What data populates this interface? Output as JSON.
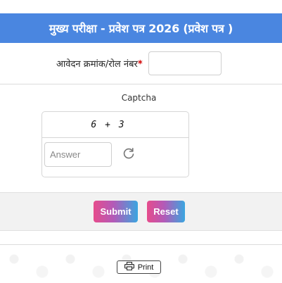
{
  "header": {
    "title": "मुख्य परीक्षा - प्रवेश पत्र 2026 (प्रवेश पत्र )"
  },
  "form": {
    "roll_label": "आवेदन क्रमांक/रोल नंबर",
    "required_mark": "*",
    "roll_value": ""
  },
  "captcha": {
    "title": "Captcha",
    "question": "6 + 3",
    "answer_placeholder": "Answer",
    "refresh_icon": "refresh-icon"
  },
  "buttons": {
    "submit": "Submit",
    "reset": "Reset"
  },
  "footer": {
    "print_label": "Print",
    "print_icon": "printer-icon"
  },
  "colors": {
    "header_bg": "#4a86e0",
    "button_gradient_start": "#e64c8c",
    "button_gradient_end": "#3aa6e0",
    "required": "#d00000"
  }
}
